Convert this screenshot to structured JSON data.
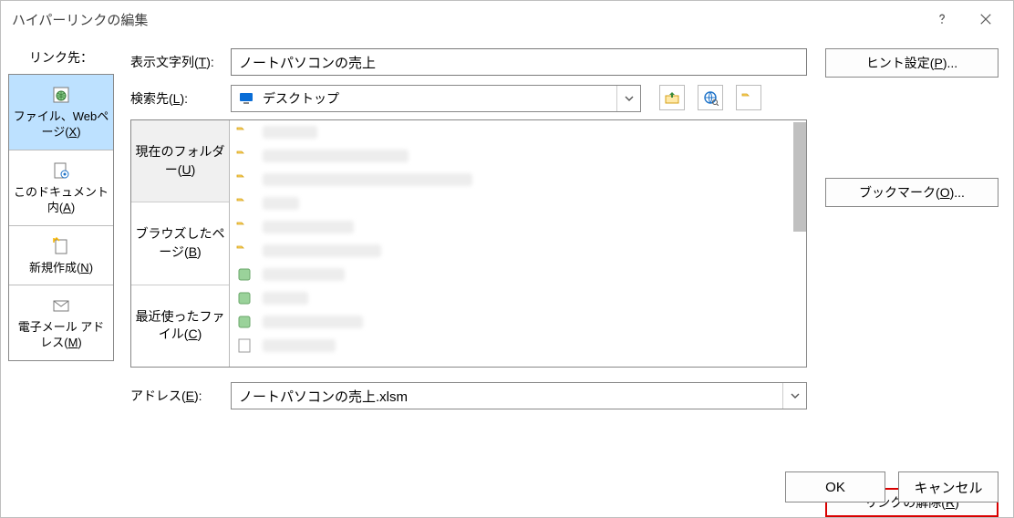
{
  "dialog": {
    "title": "ハイパーリンクの編集"
  },
  "sidebar": {
    "label": "リンク先：",
    "items": [
      {
        "label_pre": "ファイル、Webページ(",
        "key": "X",
        "label_post": ")",
        "selected": true
      },
      {
        "label_pre": "このドキュメント内(",
        "key": "A",
        "label_post": ")"
      },
      {
        "label_pre": "新規作成(",
        "key": "N",
        "label_post": ")"
      },
      {
        "label_pre": "電子メール アドレス(",
        "key": "M",
        "label_post": ")"
      }
    ]
  },
  "form": {
    "display_label_pre": "表示文字列(",
    "display_label_key": "T",
    "display_label_post": "):",
    "display_value": "ノートパソコンの売上",
    "lookin_label_pre": "検索先(",
    "lookin_label_key": "L",
    "lookin_label_post": "):",
    "lookin_value": "デスクトップ",
    "address_label_pre": "アドレス(",
    "address_label_key": "E",
    "address_label_post": "):",
    "address_value": "ノートパソコンの売上.xlsm"
  },
  "browse_tabs": [
    {
      "line1": "現在のフォルダー(",
      "key": "U",
      "post": ")",
      "selected": true
    },
    {
      "line1": "ブラウズしたページ(",
      "key": "B",
      "post": ")"
    },
    {
      "line1": "最近使ったファイル(",
      "key": "C",
      "post": ")"
    }
  ],
  "file_list": [
    {
      "type": "folder",
      "name_w": 60
    },
    {
      "type": "folder",
      "name_w": 160
    },
    {
      "type": "folder",
      "name_w": 230
    },
    {
      "type": "folder",
      "name_w": 40
    },
    {
      "type": "folder",
      "name_w": 100
    },
    {
      "type": "folder",
      "name_w": 130
    },
    {
      "type": "app",
      "name_w": 90
    },
    {
      "type": "app",
      "name_w": 50
    },
    {
      "type": "app",
      "name_w": 110
    },
    {
      "type": "file",
      "name_w": 80
    }
  ],
  "right_buttons": {
    "hint_pre": "ヒント設定(",
    "hint_key": "P",
    "hint_post": ")...",
    "bookmark_pre": "ブックマーク(",
    "bookmark_key": "O",
    "bookmark_post": ")...",
    "remove_pre": "リンクの解除(",
    "remove_key": "R",
    "remove_post": ")"
  },
  "footer": {
    "ok": "OK",
    "cancel": "キャンセル"
  }
}
